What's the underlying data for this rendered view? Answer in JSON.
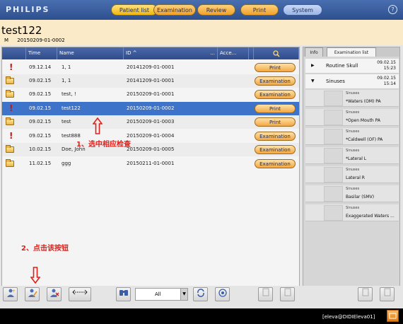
{
  "app": {
    "logo": "PHILIPS"
  },
  "nav": {
    "tabs": [
      {
        "label": "Patient list"
      },
      {
        "label": "Examination"
      },
      {
        "label": "Review"
      },
      {
        "label": "Print"
      },
      {
        "label": "System"
      }
    ],
    "help_label": "?"
  },
  "patient": {
    "name": "test122",
    "sex": "M",
    "id": "20150209-01-0002"
  },
  "table": {
    "headers": {
      "time": "Time",
      "name": "Name",
      "id": "ID ^",
      "acc": "Acce...",
      "col_dots": "...",
      "search_icon": "magnifier-icon"
    },
    "rows": [
      {
        "icon": "exclamation",
        "time": "09.12.14",
        "name": "1, 1",
        "id": "20141209-01-0001",
        "action": "Print"
      },
      {
        "icon": "folder",
        "time": "09.02.15",
        "name": "1, 1",
        "id": "20141209-01-0001",
        "action": "Examination"
      },
      {
        "icon": "folder",
        "time": "09.02.15",
        "name": "test, !",
        "id": "20150209-01-0001",
        "action": "Examination"
      },
      {
        "icon": "exclamation",
        "time": "09.02.15",
        "name": "test122",
        "id": "20150209-01-0002",
        "action": "Print",
        "selected": true
      },
      {
        "icon": "folder",
        "time": "09.02.15",
        "name": "test",
        "id": "20150209-01-0003",
        "action": "Print"
      },
      {
        "icon": "exclamation",
        "time": "09.02.15",
        "name": "test888",
        "id": "20150209-01-0004",
        "action": "Examination"
      },
      {
        "icon": "folder",
        "time": "10.02.15",
        "name": "Doe, John",
        "id": "20150209-01-0005",
        "action": "Examination"
      },
      {
        "icon": "folder",
        "time": "11.02.15",
        "name": "ggg",
        "id": "20150211-01-0001",
        "action": "Examination"
      }
    ]
  },
  "annotations": {
    "step1": "1、选中相应检查",
    "step2": "2、点击该按钮"
  },
  "right_panel": {
    "tabs": {
      "info": "Info",
      "exam_list": "Examination list"
    },
    "groups": [
      {
        "name": "Routine Skull",
        "date": "09.02.15",
        "time": "15:23",
        "expanded": false
      },
      {
        "name": "Sinuses",
        "date": "09.02.15",
        "time": "15:14",
        "expanded": true
      }
    ],
    "items": [
      {
        "group": "Sinuses",
        "label": "*Waters (OM) PA"
      },
      {
        "group": "Sinuses",
        "label": "*Open Mouth PA"
      },
      {
        "group": "Sinuses",
        "label": "*Caldwell (OF) PA"
      },
      {
        "group": "Sinuses",
        "label": "*Lateral L"
      },
      {
        "group": "Sinuses",
        "label": "Lateral R"
      },
      {
        "group": "Sinuses",
        "label": "Basilar (SMV)"
      },
      {
        "group": "Sinuses",
        "label": "Exaggerated Waters ..."
      }
    ]
  },
  "toolbar": {
    "filter_value": "All"
  },
  "status": {
    "user": "[eleva@DIDIEleva01]"
  }
}
